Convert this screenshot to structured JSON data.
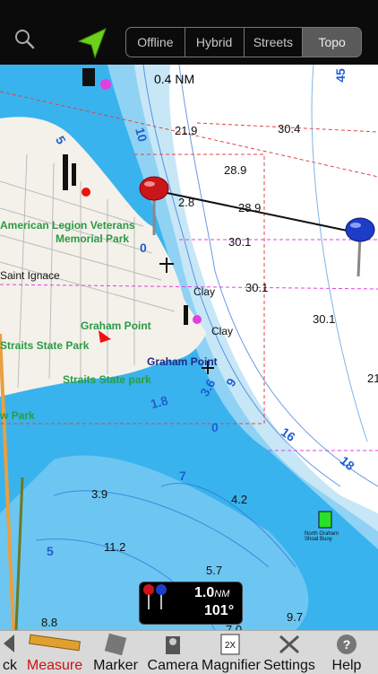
{
  "topbar": {
    "icons": {
      "search": "search-icon",
      "gps": "location-arrow-icon"
    },
    "map_types": [
      "Offline",
      "Hybrid",
      "Streets",
      "Topo"
    ],
    "selected_map_type": "Topo"
  },
  "map": {
    "scale_label": "0.4 NM",
    "places": {
      "legion_park_1": "American Legion Veterans",
      "legion_park_2": "Memorial Park",
      "saint_ignace": "Saint Ignace",
      "graham_point_green": "Graham Point",
      "graham_point_blue": "Graham Point",
      "straits_state_park": "Straits State Park",
      "straits_state_park_lower": "Straits State park",
      "w_park": "w Park",
      "clay_1": "Clay",
      "clay_2": "Clay",
      "shoal_buoy": "North Graham Shoal Buoy"
    },
    "depths": [
      "21.9",
      "30.4",
      "28.9",
      "2.8",
      "28.9",
      "30.1",
      "30.1",
      "30.1",
      "21",
      "3.9",
      "4.2",
      "11.2",
      "5.7",
      "8.8",
      "9.7",
      "7.0"
    ],
    "contour_labels": [
      "45",
      "10",
      "5",
      "0",
      "9",
      "3.6",
      "1.8",
      "16",
      "18",
      "7",
      "5",
      "0"
    ],
    "colors": {
      "deep_water": "#ffffff",
      "shallow_1": "#c7e7f7",
      "shallow_2": "#8fd2f4",
      "shallow_3": "#39b3ee",
      "land": "#f3f1e9",
      "pin_red": "#c8161a",
      "pin_blue": "#1f3cc9"
    }
  },
  "measure": {
    "distance_value": "1.0",
    "distance_unit": "NM",
    "bearing": "101°"
  },
  "toolbar": {
    "items": [
      {
        "label": "ck",
        "icon": "back-icon"
      },
      {
        "label": "Measure",
        "icon": "ruler-icon",
        "active": true
      },
      {
        "label": "Marker",
        "icon": "marker-icon"
      },
      {
        "label": "Camera",
        "icon": "camera-icon"
      },
      {
        "label": "Magnifier",
        "icon": "magnifier-icon",
        "badge": "2X"
      },
      {
        "label": "Settings",
        "icon": "settings-tools-icon"
      },
      {
        "label": "Help",
        "icon": "help-icon"
      }
    ]
  }
}
